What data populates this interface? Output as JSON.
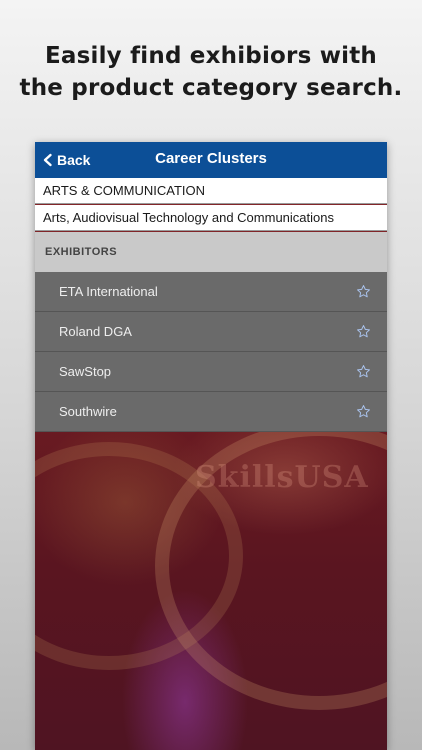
{
  "promo": {
    "headline_line1": "Easily find exhibiors with",
    "headline_line2": "the product category search."
  },
  "nav": {
    "back_label": "Back",
    "title": "Career Clusters"
  },
  "category": "ARTS & COMMUNICATION",
  "subcategory": "Arts, Audiovisual Technology and Communications",
  "section_header": "EXHIBITORS",
  "exhibitors": [
    {
      "name": "ETA International"
    },
    {
      "name": "Roland DGA"
    },
    {
      "name": "SawStop"
    },
    {
      "name": "Southwire"
    }
  ],
  "background_text": "SkillsUSA",
  "colors": {
    "nav_bar": "#0c4f97",
    "star": "#a9c2ec",
    "row_bg": "#6a6a6a",
    "section_bg": "#c9c9c9"
  },
  "icons": {
    "back": "chevron-left-icon",
    "favorite": "star-outline-icon"
  }
}
